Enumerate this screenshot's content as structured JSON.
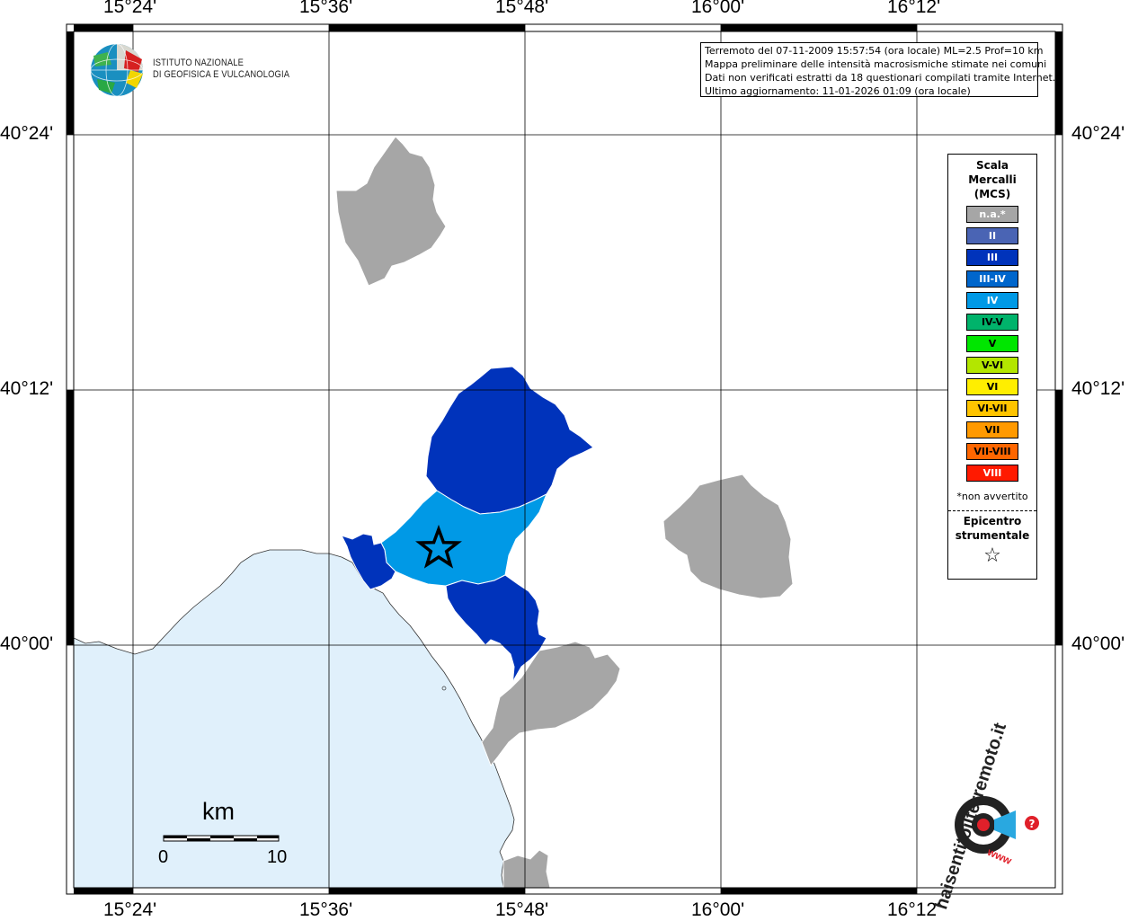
{
  "map": {
    "lon_labels": [
      "15°24'",
      "15°36'",
      "15°48'",
      "16°00'",
      "16°12'"
    ],
    "lat_labels": [
      "40°24'",
      "40°12'",
      "40°00'"
    ]
  },
  "logo": {
    "line1": "ISTITUTO NAZIONALE",
    "line2": "DI GEOFISICA E VULCANOLOGIA"
  },
  "info_box": {
    "line1": "Terremoto del 07-11-2009 15:57:54 (ora locale) ML=2.5 Prof=10 km",
    "line2": "Mappa preliminare delle intensità macrosismiche stimate nei comuni",
    "line3": "Dati non verificati estratti da 18 questionari compilati tramite Internet.",
    "line4": "Ultimo aggiornamento: 11-01-2026 01:09 (ora locale)"
  },
  "legend": {
    "title": "Scala\nMercalli\n(MCS)",
    "items": [
      {
        "label": "n.a.*",
        "color": "#a6a6a6",
        "text_color": "#ffffff"
      },
      {
        "label": "II",
        "color": "#4a64b4",
        "text_color": "#ffffff"
      },
      {
        "label": "III",
        "color": "#0033bb",
        "text_color": "#ffffff"
      },
      {
        "label": "III-IV",
        "color": "#0066cc",
        "text_color": "#ffffff"
      },
      {
        "label": "IV",
        "color": "#0099e6",
        "text_color": "#ffffff"
      },
      {
        "label": "IV-V",
        "color": "#00b36b",
        "text_color": "#000000"
      },
      {
        "label": "V",
        "color": "#00e600",
        "text_color": "#000000"
      },
      {
        "label": "V-VI",
        "color": "#b3e600",
        "text_color": "#000000"
      },
      {
        "label": "VI",
        "color": "#ffee00",
        "text_color": "#000000"
      },
      {
        "label": "VI-VII",
        "color": "#ffc400",
        "text_color": "#000000"
      },
      {
        "label": "VII",
        "color": "#ff9900",
        "text_color": "#000000"
      },
      {
        "label": "VII-VIII",
        "color": "#ff6600",
        "text_color": "#000000"
      },
      {
        "label": "VIII",
        "color": "#ff1a00",
        "text_color": "#ffffff"
      }
    ],
    "note": "*non avvertito",
    "epicenter_label": "Epicentro\nstrumentale",
    "epicenter_symbol": "☆"
  },
  "scale_bar": {
    "unit": "km",
    "min_label": "0",
    "max_label": "10"
  },
  "colors": {
    "sea": "#e0f0fb",
    "na": "#a6a6a6",
    "intensity_III": "#0033bb",
    "intensity_IV": "#0099e6",
    "grid": "#000000"
  },
  "watermark": {
    "text": "haisentitoilterremoto.it",
    "url": "www"
  }
}
